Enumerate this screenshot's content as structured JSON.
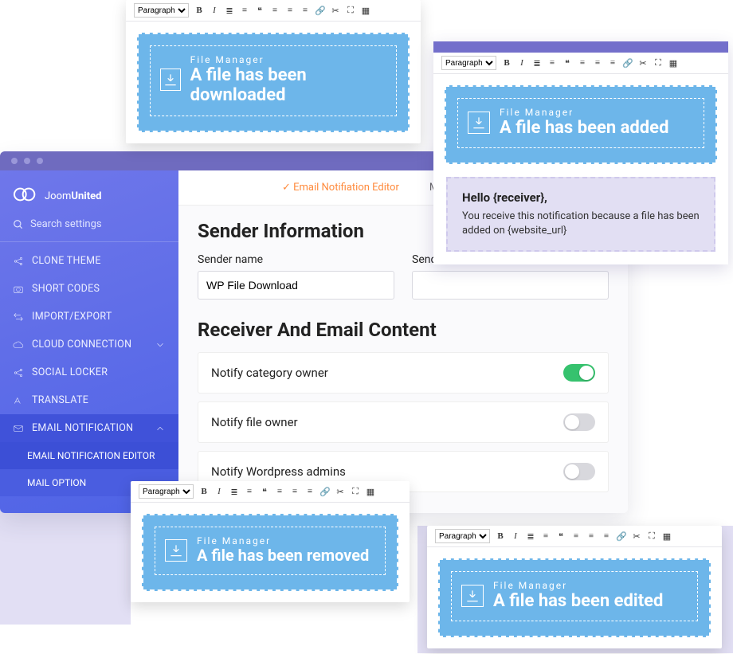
{
  "editor_select": "Paragraph",
  "banner_kicker": "File Manager",
  "banners": {
    "downloaded": "A file has been downloaded",
    "added": "A file has been added",
    "removed": "A file has been removed",
    "edited": "A file has been edited"
  },
  "preview": {
    "hello": "Hello {receiver},",
    "body": "You receive this notification because a file has been added on {website_url}"
  },
  "app": {
    "brand": "JoomUnited",
    "search_placeholder": "Search settings",
    "nav": {
      "clone": "CLONE THEME",
      "short": "SHORT CODES",
      "import": "IMPORT/EXPORT",
      "cloud": "CLOUD CONNECTION",
      "social": "SOCIAL LOCKER",
      "translate": "TRANSLATE",
      "email": "EMAIL NOTIFICATION",
      "sub_editor": "EMAIL NOTIFICATION EDITOR",
      "sub_mail": "MAIL OPTION"
    },
    "tabs": {
      "editor": "Email Notifiation Editor",
      "mail": "M"
    },
    "section1_title": "Sender Information",
    "sender_name_lbl": "Sender name",
    "sender_name_val": "WP File Download",
    "sender_mail_lbl": "Sender mail",
    "sender_mail_val": "",
    "section2_title": "Receiver And Email Content",
    "opts": {
      "cat_owner": "Notify category owner",
      "file_owner": "Notify file owner",
      "wp_admin": "Notify Wordpress admins"
    },
    "toggles": {
      "cat_owner": true,
      "file_owner": false,
      "wp_admin": false
    }
  }
}
